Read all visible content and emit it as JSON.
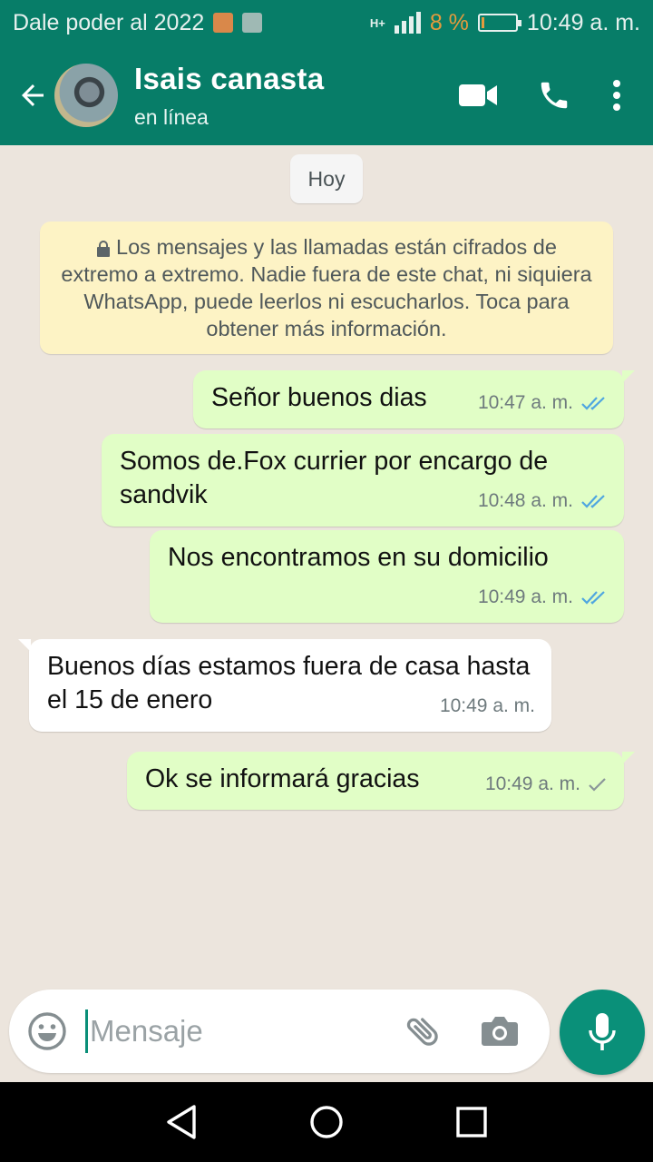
{
  "status_bar": {
    "carrier_text": "Dale poder al 2022",
    "network_type": "H+",
    "battery_percent": "8 %",
    "battery_level": 0.08,
    "time": "10:49 a. m.",
    "colors": {
      "battery_low": "#e39b3d"
    }
  },
  "header": {
    "contact_name": "Isais canasta",
    "contact_status": "en línea",
    "icons": {
      "back": "arrow-left-icon",
      "video": "video-call-icon",
      "call": "phone-icon",
      "menu": "more-vertical-icon"
    }
  },
  "chat": {
    "date_chip": "Hoy",
    "encryption_notice": "Los mensajes y las llamadas están cifrados de extremo a extremo. Nadie fuera de este chat, ni siquiera WhatsApp, puede leerlos ni escucharlos. Toca para obtener más información.",
    "messages": [
      {
        "direction": "out",
        "text": "Señor buenos dias",
        "time": "10:47 a. m.",
        "status": "read"
      },
      {
        "direction": "out",
        "text": "Somos de.Fox currier por encargo de sandvik",
        "time": "10:48 a. m.",
        "status": "read"
      },
      {
        "direction": "out",
        "text": "Nos encontramos en su domicilio",
        "time": "10:49 a. m.",
        "status": "read"
      },
      {
        "direction": "in",
        "text": "Buenos días estamos fuera de casa hasta el 15 de enero",
        "time": "10:49 a. m."
      },
      {
        "direction": "out",
        "text": "Ok se informará gracias",
        "time": "10:49 a. m.",
        "status": "sent"
      }
    ]
  },
  "composer": {
    "placeholder": "Mensaje",
    "value": ""
  },
  "colors": {
    "header_bg": "#077d68",
    "outgoing_bubble": "#e1fec6",
    "incoming_bubble": "#ffffff",
    "read_ticks": "#4fa6e0",
    "sent_tick": "#8a9699",
    "mic_button": "#0a9079",
    "chat_bg": "#ece5dd"
  }
}
